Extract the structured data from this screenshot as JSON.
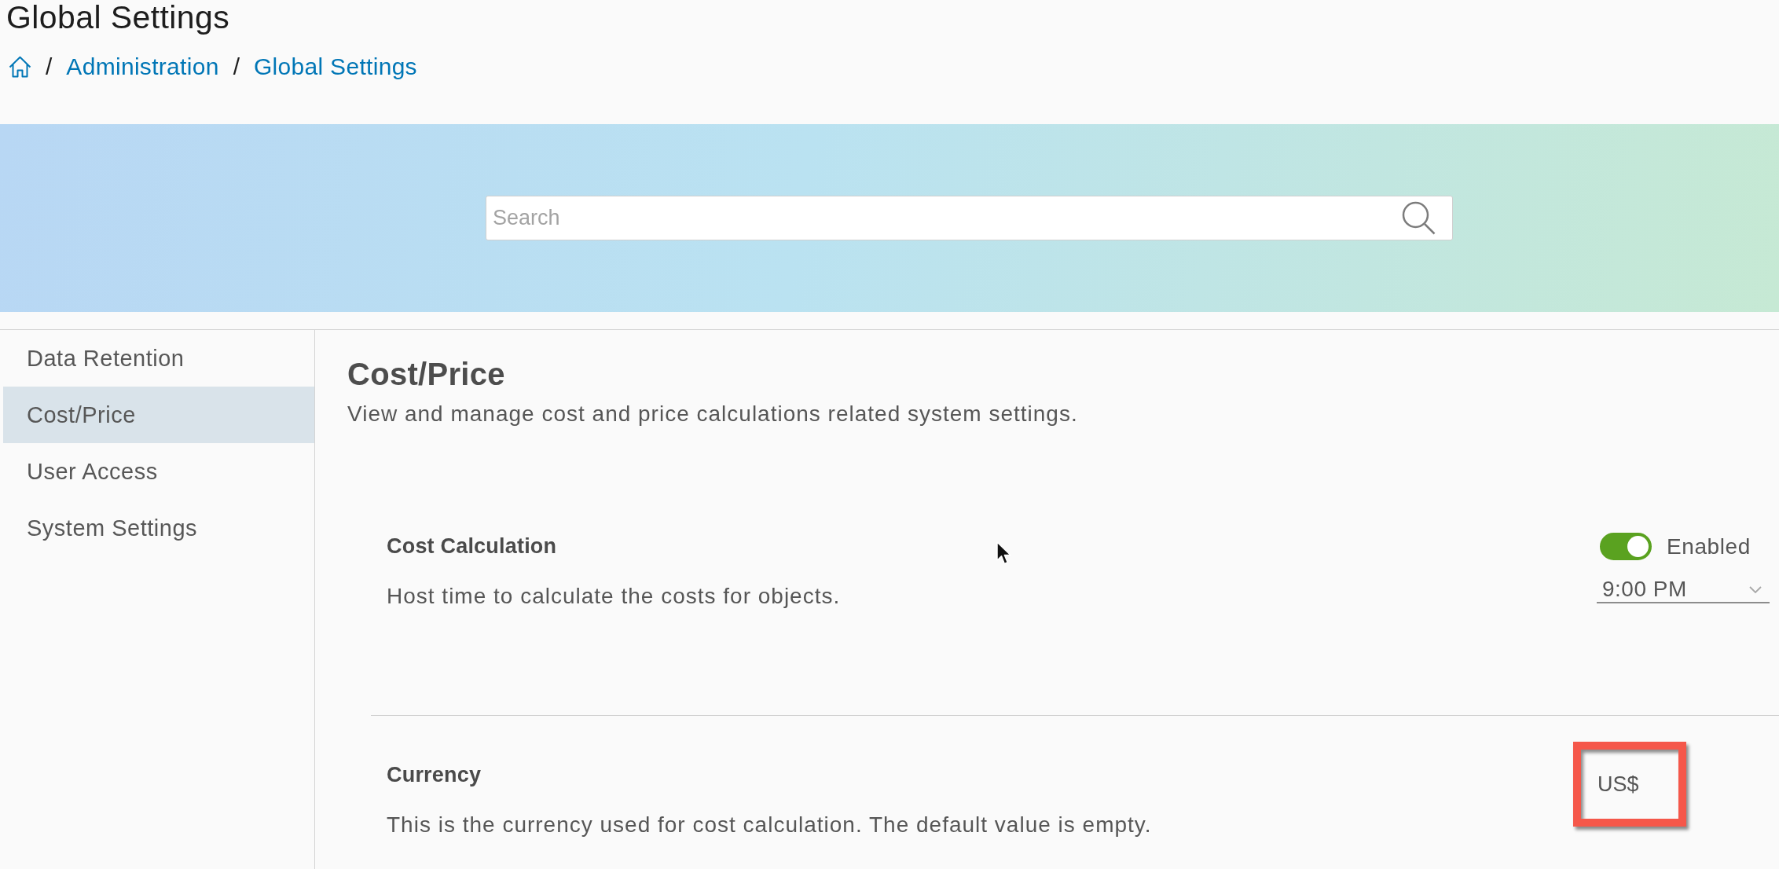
{
  "page": {
    "title": "Global Settings"
  },
  "breadcrumb": [
    {
      "kind": "home"
    },
    {
      "kind": "separator",
      "text": "/"
    },
    {
      "kind": "link",
      "label": "Administration"
    },
    {
      "kind": "separator",
      "text": "/"
    },
    {
      "kind": "link",
      "label": "Global Settings"
    }
  ],
  "search": {
    "placeholder": "Search"
  },
  "sidebar": {
    "items": [
      {
        "label": "Data Retention",
        "selected": false
      },
      {
        "label": "Cost/Price",
        "selected": true
      },
      {
        "label": "User Access",
        "selected": false
      },
      {
        "label": "System Settings",
        "selected": false
      }
    ]
  },
  "section": {
    "title": "Cost/Price",
    "description": "View and manage cost and price calculations related system settings."
  },
  "settings": [
    {
      "kind": "schedule",
      "title": "Cost Calculation",
      "description": "Host time to calculate the costs for objects.",
      "toggle": {
        "on": true,
        "label": "Enabled"
      },
      "time": "9:00 PM"
    },
    {
      "kind": "value",
      "title": "Currency",
      "description": "This is the currency used for cost calculation. The default value is empty.",
      "value": "US$",
      "highlighted": true
    }
  ]
}
